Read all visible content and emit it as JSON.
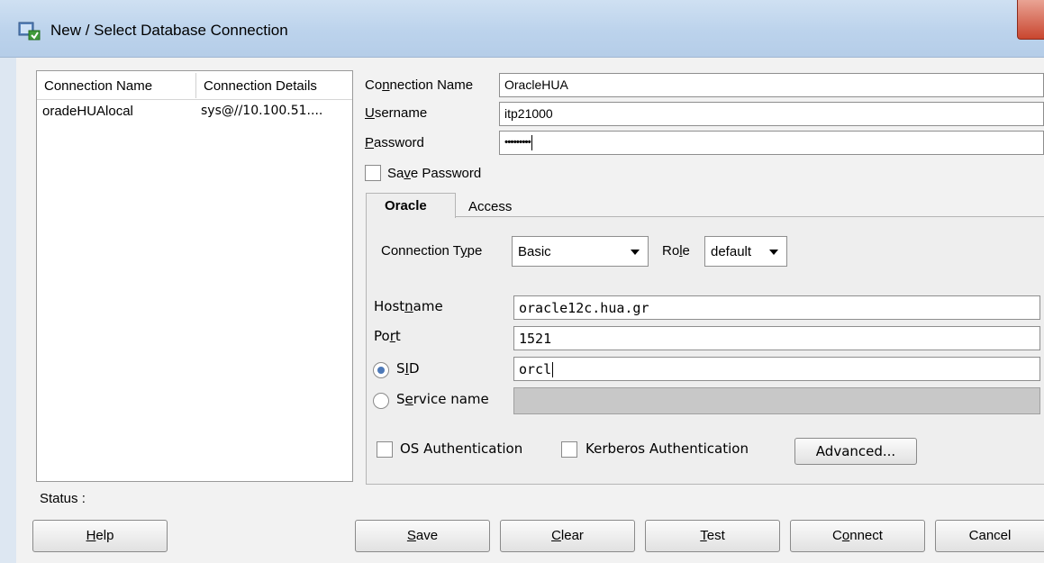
{
  "window": {
    "title": "New / Select Database Connection"
  },
  "connections_table": {
    "headers": [
      "Connection Name",
      "Connection Details"
    ],
    "rows": [
      {
        "name": "oradeHUAlocal",
        "details": "sys@//10.100.51...."
      }
    ]
  },
  "form": {
    "connection_name": {
      "label": "Connection Name",
      "value": "OracleHUA"
    },
    "username": {
      "label": "Username",
      "value": "itp21000"
    },
    "password": {
      "label": "Password",
      "value": "•••••••••"
    },
    "save_password": {
      "label": "Save Password",
      "checked": false
    }
  },
  "tabs": [
    {
      "label": "Oracle",
      "active": true
    },
    {
      "label": "Access",
      "active": false
    }
  ],
  "oracle": {
    "connection_type": {
      "label": "Connection Type",
      "value": "Basic"
    },
    "role": {
      "label": "Role",
      "value": "default"
    },
    "hostname": {
      "label": "Hostname",
      "value": "oracle12c.hua.gr"
    },
    "port": {
      "label": "Port",
      "value": "1521"
    },
    "sid": {
      "label": "SID",
      "value": "orcl",
      "selected": true
    },
    "service_name": {
      "label": "Service name",
      "value": "",
      "selected": false
    },
    "os_auth": {
      "label": "OS Authentication",
      "checked": false
    },
    "kerberos_auth": {
      "label": "Kerberos Authentication",
      "checked": false
    },
    "advanced_label": "Advanced..."
  },
  "status": {
    "label": "Status :"
  },
  "buttons": {
    "help": "Help",
    "save": "Save",
    "clear": "Clear",
    "test": "Test",
    "connect": "Connect",
    "cancel": "Cancel"
  },
  "colors": {
    "titlebar": "#bcd3ec",
    "close": "#c9462f",
    "radio_dot": "#4d79b8"
  }
}
